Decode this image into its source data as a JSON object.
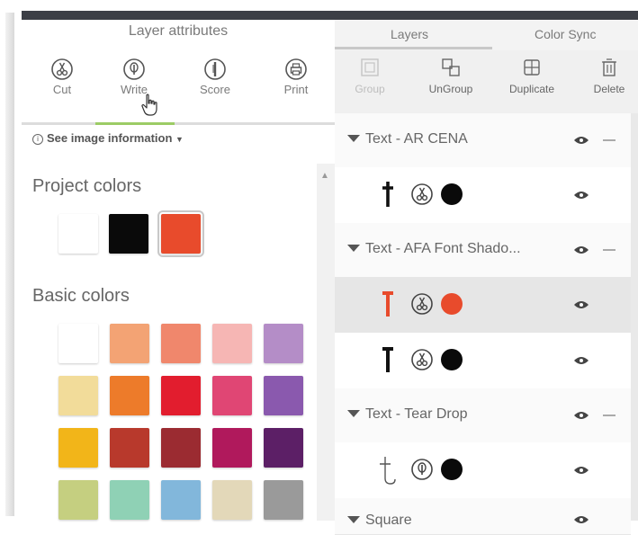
{
  "layer_attributes": {
    "title": "Layer attributes",
    "tools": [
      {
        "label": "Cut",
        "icon": "scissors-icon"
      },
      {
        "label": "Write",
        "icon": "pen-icon"
      },
      {
        "label": "Score",
        "icon": "score-icon"
      },
      {
        "label": "Print",
        "icon": "printer-icon"
      }
    ],
    "see_info": "See image information"
  },
  "project_colors": {
    "heading": "Project colors",
    "swatches": [
      "#ffffff",
      "#0a0a0a",
      "#e84b2c"
    ]
  },
  "basic_colors": {
    "heading": "Basic colors",
    "rows": [
      [
        "#ffffff",
        "#f3a374",
        "#f0876c",
        "#f6b6b4",
        "#b48dc7"
      ],
      [
        "#f2dc9a",
        "#ed7b2a",
        "#e21d2e",
        "#e04674",
        "#8a59ae"
      ],
      [
        "#f2b519",
        "#b8392c",
        "#9b2b31",
        "#b0195c",
        "#5c1f66"
      ],
      [
        "#c5cf80",
        "#8fd1b5",
        "#82b7db",
        "#e3d8b9",
        "#9a9a9a"
      ]
    ]
  },
  "layers_panel": {
    "tabs": [
      "Layers",
      "Color Sync"
    ],
    "actions": [
      {
        "label": "Group",
        "icon": "group-icon",
        "enabled": false
      },
      {
        "label": "UnGroup",
        "icon": "ungroup-icon",
        "enabled": true
      },
      {
        "label": "Duplicate",
        "icon": "duplicate-icon",
        "enabled": true
      },
      {
        "label": "Delete",
        "icon": "trash-icon",
        "enabled": true
      }
    ],
    "rows": [
      {
        "type": "group",
        "name": "Text - AR CENA"
      },
      {
        "type": "child",
        "tool": "cut",
        "color": "#0a0a0a"
      },
      {
        "type": "group",
        "name": "Text - AFA Font Shado..."
      },
      {
        "type": "child",
        "tool": "cut",
        "color": "#e84b2c",
        "selected": true
      },
      {
        "type": "child",
        "tool": "cut",
        "color": "#0a0a0a"
      },
      {
        "type": "group",
        "name": "Text - Tear Drop"
      },
      {
        "type": "child",
        "tool": "write",
        "color": "#0a0a0a"
      },
      {
        "type": "group",
        "name": "Square"
      }
    ]
  }
}
